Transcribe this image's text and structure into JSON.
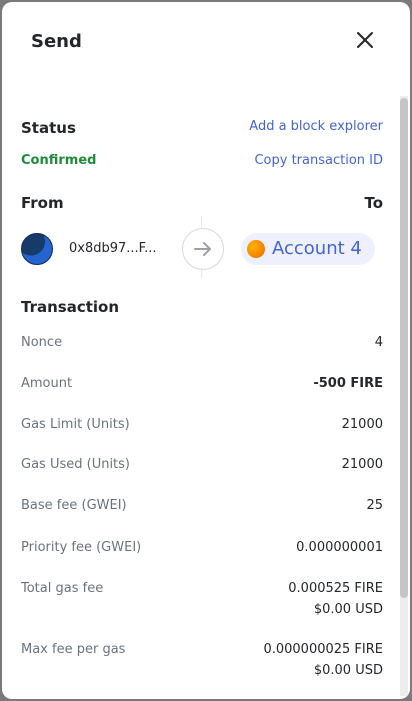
{
  "header": {
    "title": "Send"
  },
  "status": {
    "title": "Status",
    "value": "Confirmed",
    "explorer_link": "Add a block explorer",
    "copy_link": "Copy transaction ID"
  },
  "parties": {
    "from_label": "From",
    "to_label": "To",
    "from_address": "0x8db97...F...",
    "to_account": "Account 4"
  },
  "transaction": {
    "title": "Transaction",
    "rows": [
      {
        "label": "Nonce",
        "value": "4"
      },
      {
        "label": "Amount",
        "value": "-500 FIRE"
      },
      {
        "label": "Gas Limit (Units)",
        "value": "21000"
      },
      {
        "label": "Gas Used (Units)",
        "value": "21000"
      },
      {
        "label": "Base fee (GWEI)",
        "value": "25"
      },
      {
        "label": "Priority fee (GWEI)",
        "value": "0.000000001"
      },
      {
        "label": "Total gas fee",
        "value": "0.000525 FIRE",
        "sub": "$0.00 USD"
      },
      {
        "label": "Max fee per gas",
        "value": "0.000000025 FIRE",
        "sub": "$0.00 USD"
      }
    ]
  },
  "colors": {
    "link": "#4363d8",
    "confirmed": "#1f8c3a",
    "muted": "#6a737d"
  }
}
